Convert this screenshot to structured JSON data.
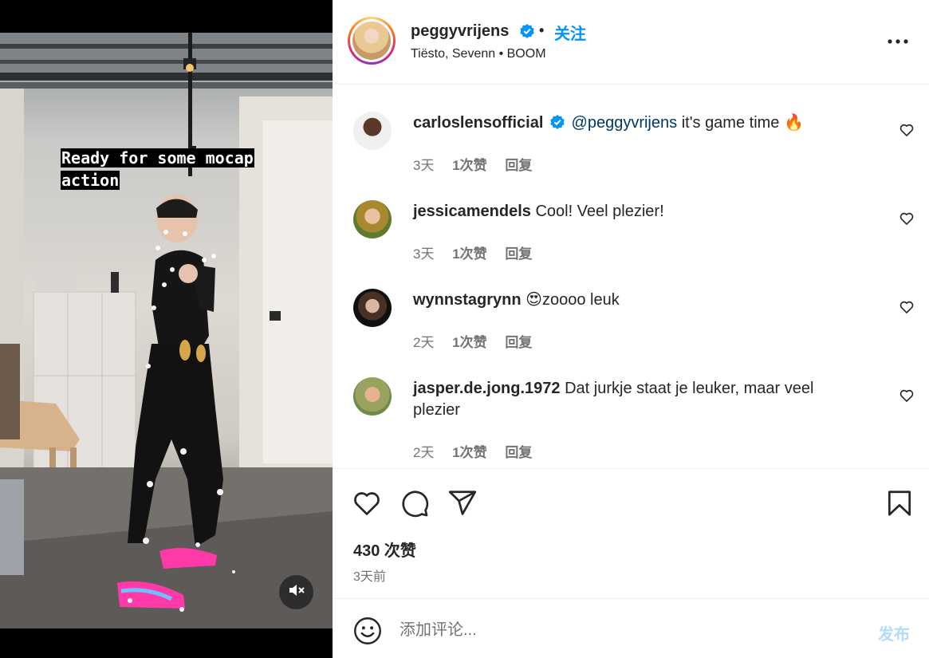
{
  "media": {
    "caption_line1": "Ready for some mocap",
    "caption_line2": "action"
  },
  "header": {
    "username": "peggyvrijens",
    "separator": "•",
    "follow_label": "关注",
    "audio": "Tiësto, Sevenn • BOOM"
  },
  "comments": [
    {
      "user": "carloslensofficial",
      "verified": true,
      "mention": "@peggyvrijens",
      "text": "it's game time 🔥",
      "time": "3天",
      "likes": "1次赞",
      "reply": "回复"
    },
    {
      "user": "jessicamendels",
      "verified": false,
      "text": "Cool! Veel plezier!",
      "time": "3天",
      "likes": "1次赞",
      "reply": "回复"
    },
    {
      "user": "wynnstagrynn",
      "verified": false,
      "text": "😍zoooo leuk",
      "time": "2天",
      "likes": "1次赞",
      "reply": "回复"
    },
    {
      "user": "jasper.de.jong.1972",
      "verified": false,
      "text": "Dat jurkje staat je leuker, maar veel plezier",
      "time": "2天",
      "likes": "1次赞",
      "reply": "回复"
    }
  ],
  "stats": {
    "likes": "430 次赞",
    "posted": "3天前"
  },
  "composer": {
    "placeholder": "添加评论...",
    "post_label": "发布"
  },
  "colors": {
    "accent": "#0095f6",
    "verified": "#0095f6",
    "muted_text": "#737373",
    "post_disabled": "#b3dbff"
  },
  "icons": [
    "verified-badge-icon",
    "more-options-icon",
    "heart-icon",
    "comment-icon",
    "share-icon",
    "bookmark-icon",
    "emoji-icon",
    "mute-icon"
  ]
}
